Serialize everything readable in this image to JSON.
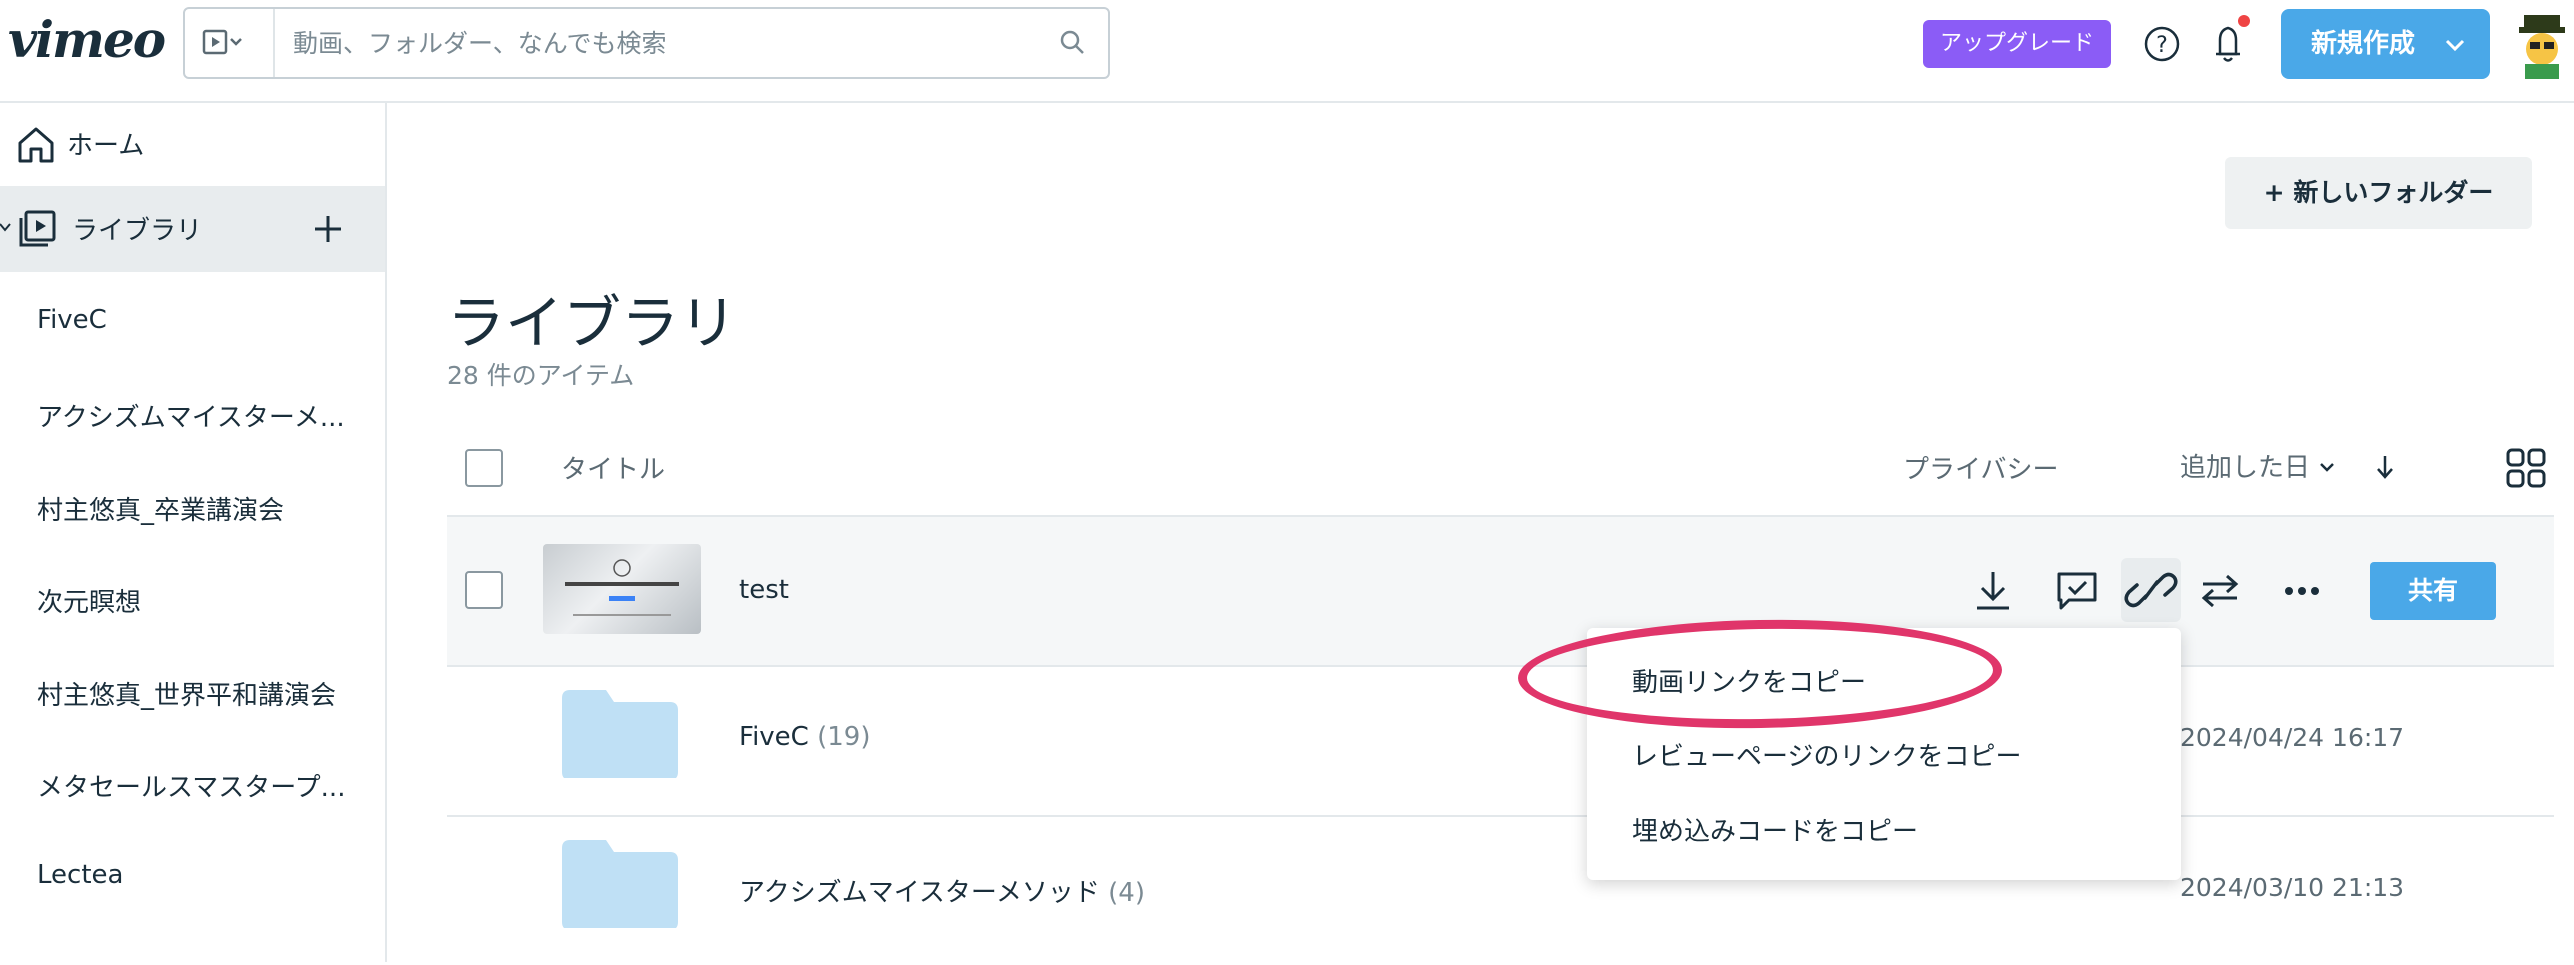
{
  "header": {
    "logo": "vimeo",
    "search_placeholder": "動画、フォルダー、なんでも検索",
    "upgrade_label": "アップグレード",
    "new_label": "新規作成",
    "notification_dot_color": "#ef4444"
  },
  "sidebar": {
    "home_label": "ホーム",
    "library_label": "ライブラリ",
    "items": [
      "FiveC",
      "アクシズムマイスターメ...",
      "村主悠真_卒業講演会",
      "次元瞑想",
      "村主悠真_世界平和講演会",
      "メタセールスマスタープ...",
      "Lectea"
    ]
  },
  "main": {
    "new_folder_label": "+ 新しいフォルダー",
    "page_title": "ライブラリ",
    "item_count": "28 件のアイテム",
    "columns": {
      "title": "タイトル",
      "privacy": "プライバシー",
      "date_added": "追加した日"
    },
    "rows": [
      {
        "title": "test",
        "count": "",
        "date": ""
      },
      {
        "title": "FiveC",
        "count": "(19)",
        "date": "2024/04/24 16:17"
      },
      {
        "title": "アクシズムマイスターメソッド",
        "count": "(4)",
        "date": "2024/03/10 21:13"
      }
    ],
    "share_label": "共有"
  },
  "context_menu": {
    "items": [
      "動画リンクをコピー",
      "レビューページのリンクをコピー",
      "埋め込みコードをコピー"
    ]
  },
  "colors": {
    "accent": "#4aa8e8",
    "upgrade": "#8b5cf6",
    "highlight": "#e0356a"
  }
}
